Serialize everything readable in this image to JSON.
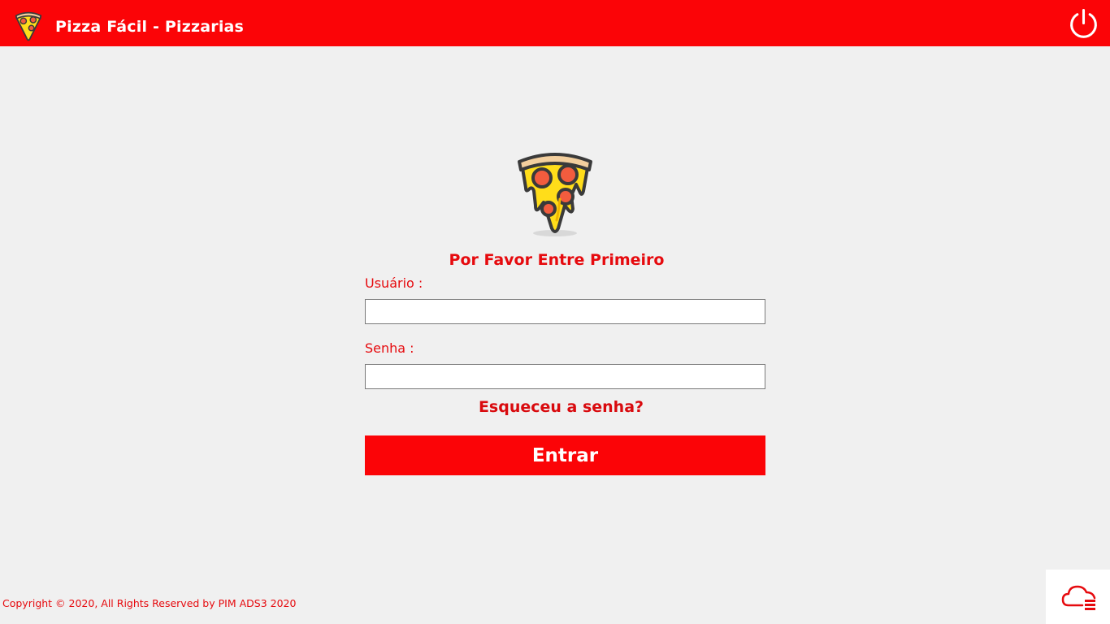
{
  "header": {
    "title": "Pizza Fácil - Pizzarias",
    "logo_icon": "pizza-slice-icon",
    "power_icon": "power-icon"
  },
  "login": {
    "logo_icon": "pizza-slice-icon",
    "prompt": "Por Favor Entre Primeiro",
    "username_label": "Usuário :",
    "username_value": "",
    "password_label": "Senha :",
    "password_value": "",
    "forgot_password": "Esqueceu a senha?",
    "submit_label": "Entrar"
  },
  "footer": {
    "copyright": "Copyright © 2020, All Rights Reserved by PIM ADS3 2020",
    "cloud_icon": "cloud-database-icon"
  },
  "colors": {
    "accent": "#fb0407",
    "text_accent": "#e60a0e",
    "background": "#f0f0f0"
  }
}
